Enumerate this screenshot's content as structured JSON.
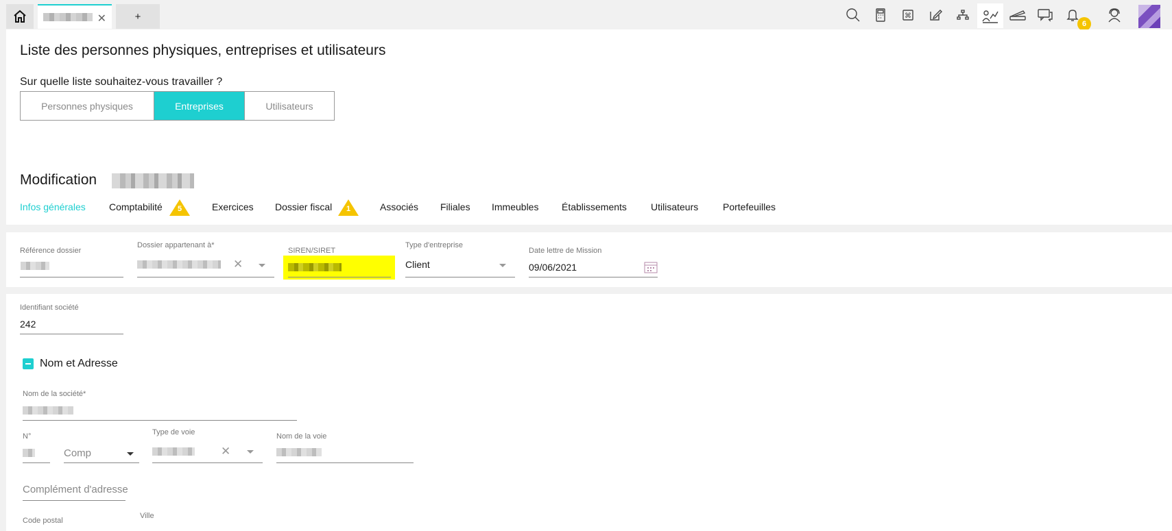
{
  "topbar": {
    "add_tab_label": "+",
    "notif_count": "6",
    "icons": [
      "home-icon",
      "close-icon",
      "search-icon",
      "calculator-icon",
      "command-icon",
      "edit-icon",
      "org-chart-icon",
      "users-chart-icon",
      "scanner-icon",
      "chat-icon",
      "bell-icon",
      "support-agent-icon",
      "avatar"
    ]
  },
  "page": {
    "title": "Liste des personnes physiques, entreprises et utilisateurs",
    "question": "Sur quelle liste souhaitez-vous travailler ?",
    "segments": [
      "Personnes physiques",
      "Entreprises",
      "Utilisateurs"
    ],
    "selected_segment": "Entreprises"
  },
  "modification": {
    "title": "Modification",
    "tabs": [
      {
        "label": "Infos générales",
        "active": true
      },
      {
        "label": "Comptabilité",
        "badge": "5"
      },
      {
        "label": "Exercices"
      },
      {
        "label": "Dossier fiscal",
        "badge": "1"
      },
      {
        "label": "Associés"
      },
      {
        "label": "Filiales"
      },
      {
        "label": "Immeubles"
      },
      {
        "label": "Établissements"
      },
      {
        "label": "Utilisateurs"
      },
      {
        "label": "Portefeuilles"
      }
    ]
  },
  "form": {
    "reference_label": "Référence dossier",
    "owner_label": "Dossier appartenant à*",
    "siren_label": "SIREN/SIRET",
    "type_label": "Type d'entreprise",
    "type_value": "Client",
    "date_label": "Date lettre de Mission",
    "date_value": "09/06/2021",
    "id_label": "Identifiant société",
    "id_value": "242",
    "section_title": "Nom et Adresse",
    "company_name_label": "Nom de la société*",
    "num_label": "N°",
    "comp_placeholder": "Comp",
    "street_type_label": "Type de voie",
    "street_name_label": "Nom de la voie",
    "complement_placeholder": "Complément d'adresse",
    "postal_label": "Code postal",
    "city_label": "Ville"
  },
  "colors": {
    "accent": "#1ecfd0",
    "warning": "#f5c400",
    "highlight": "#ffff00"
  }
}
